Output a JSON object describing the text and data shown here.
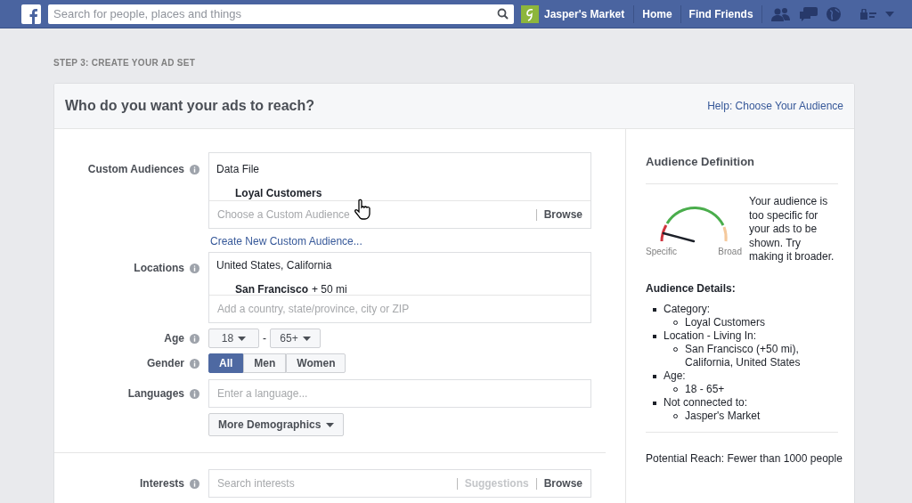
{
  "topbar": {
    "search_placeholder": "Search for people, places and things",
    "profile": "Jasper's Market",
    "nav": [
      "Home",
      "Find Friends"
    ]
  },
  "step": "STEP 3: CREATE YOUR AD SET",
  "card": {
    "title": "Who do you want your ads to reach?",
    "help_link": "Help: Choose Your Audience"
  },
  "form": {
    "custom_audiences": {
      "label": "Custom Audiences",
      "group": "Data File",
      "item": "Loyal Customers",
      "placeholder": "Choose a Custom Audience",
      "browse": "Browse",
      "create_link": "Create New Custom Audience..."
    },
    "locations": {
      "label": "Locations",
      "group": "United States, California",
      "item": "San Francisco",
      "radius": "+ 50 mi",
      "placeholder": "Add a country, state/province, city or ZIP"
    },
    "age": {
      "label": "Age",
      "min": "18",
      "separator": "-",
      "max": "65+"
    },
    "gender": {
      "label": "Gender",
      "options": [
        {
          "label": "All",
          "selected": true
        },
        {
          "label": "Men",
          "selected": false
        },
        {
          "label": "Women",
          "selected": false
        }
      ]
    },
    "languages": {
      "label": "Languages",
      "placeholder": "Enter a language..."
    },
    "more_button": "More Demographics",
    "interests": {
      "label": "Interests",
      "placeholder": "Search interests",
      "suggestions": "Suggestions",
      "browse": "Browse"
    }
  },
  "audience_panel": {
    "title": "Audience Definition",
    "gauge": {
      "min_label": "Specific",
      "max_label": "Broad"
    },
    "message": "Your audience is too specific for your ads to be shown. Try making it broader.",
    "details_title": "Audience Details:",
    "details": [
      {
        "label": "Category:",
        "children": [
          {
            "label": "Loyal Customers"
          }
        ]
      },
      {
        "label": "Location - Living In:",
        "children": [
          {
            "label": "San Francisco (+50 mi), California, United States"
          }
        ]
      },
      {
        "label": "Age:",
        "children": [
          {
            "label": "18 - 65+"
          }
        ]
      },
      {
        "label": "Not connected to:",
        "children": [
          {
            "label": "Jasper's Market"
          }
        ]
      }
    ],
    "reach": "Potential Reach: Fewer than 1000 people"
  }
}
